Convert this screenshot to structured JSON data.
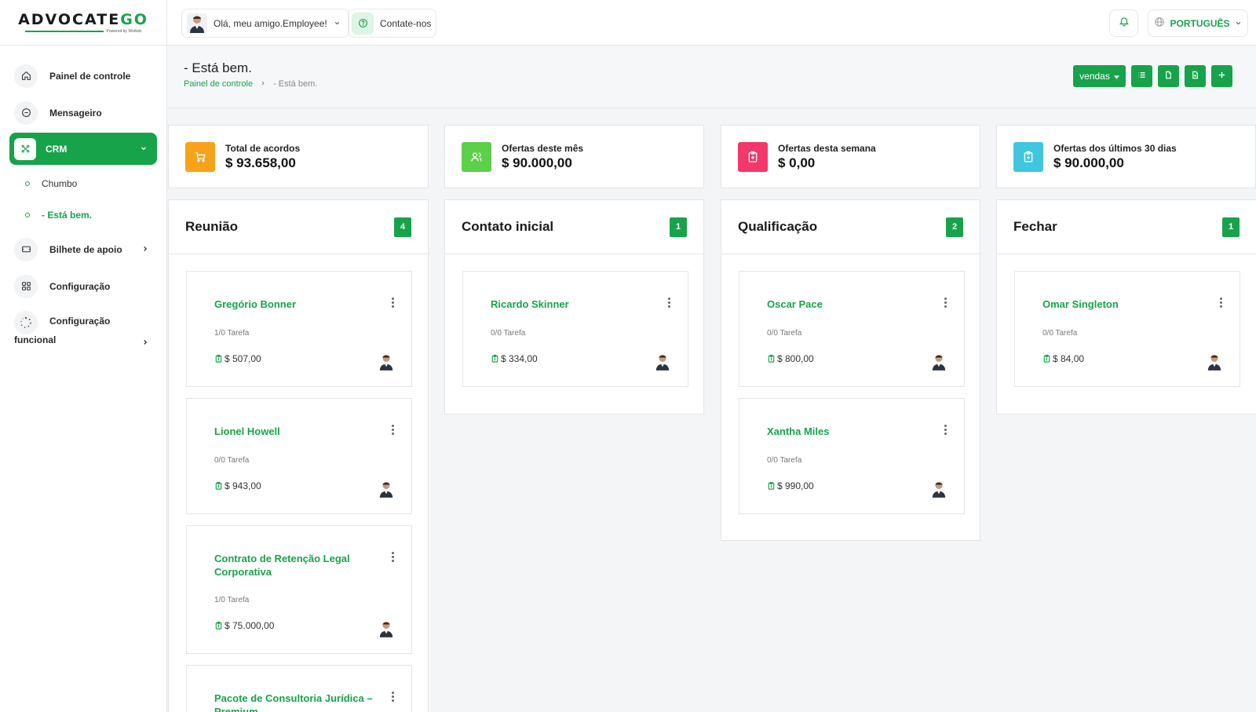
{
  "brand": {
    "name_a": "ADVOCATE",
    "name_b": "GO",
    "powered": "Powered by Workdo"
  },
  "colors": {
    "accent": "#17a34a",
    "orange": "#f7a21b",
    "lime": "#5cd048",
    "pink": "#f4376b",
    "cyan": "#3ec7de"
  },
  "sidebar": {
    "items": [
      {
        "label": "Painel de controle",
        "icon": "home-icon"
      },
      {
        "label": "Mensageiro",
        "icon": "chat-icon"
      },
      {
        "label": "CRM",
        "icon": "crm-icon"
      },
      {
        "label": "Bilhete de apoio",
        "icon": "ticket-icon"
      },
      {
        "label": "Configuração",
        "icon": "grid-icon"
      },
      {
        "label": "Configuração",
        "label2": "funcional",
        "icon": "loader-icon"
      }
    ],
    "sub": [
      {
        "label": "Chumbo"
      },
      {
        "label": "- Está bem."
      }
    ]
  },
  "topbar": {
    "greeting": "Olá, meu amigo.Employee!",
    "contact": "Contate-nos",
    "language": "PORTUGUÊS"
  },
  "page": {
    "title": "- Está bem.",
    "crumb_home": "Painel de controle",
    "crumb_current": "- Está bem.",
    "vendas_label": "vendas"
  },
  "stats": [
    {
      "label": "Total de acordos",
      "value": "$ 93.658,00",
      "icon": "cart-icon"
    },
    {
      "label": "Ofertas deste mês",
      "value": "$ 90.000,00",
      "icon": "users-icon"
    },
    {
      "label": "Ofertas desta semana",
      "value": "$ 0,00",
      "icon": "clipboard-icon"
    },
    {
      "label": "Ofertas dos últimos 30 dias",
      "value": "$ 90.000,00",
      "icon": "clipboard-icon"
    }
  ],
  "columns": [
    {
      "title": "Reunião",
      "count": "4",
      "cards": [
        {
          "name": "Gregório Bonner",
          "task": "1/0 Tarefa",
          "amount": "$ 507,00"
        },
        {
          "name": "Lionel Howell",
          "task": "0/0 Tarefa",
          "amount": "$ 943,00"
        },
        {
          "name": "Contrato de Retenção Legal Corporativa",
          "task": "1/0 Tarefa",
          "amount": "$ 75.000,00"
        },
        {
          "name": "Pacote de Consultoria Jurídica – Premium",
          "task": "",
          "amount": ""
        }
      ]
    },
    {
      "title": "Contato inicial",
      "count": "1",
      "cards": [
        {
          "name": "Ricardo Skinner",
          "task": "0/0 Tarefa",
          "amount": "$ 334,00"
        }
      ]
    },
    {
      "title": "Qualificação",
      "count": "2",
      "cards": [
        {
          "name": "Oscar Pace",
          "task": "0/0 Tarefa",
          "amount": "$ 800,00"
        },
        {
          "name": "Xantha Miles",
          "task": "0/0 Tarefa",
          "amount": "$ 990,00"
        }
      ]
    },
    {
      "title": "Fechar",
      "count": "1",
      "cards": [
        {
          "name": "Omar Singleton",
          "task": "0/0 Tarefa",
          "amount": "$ 84,00"
        }
      ]
    }
  ]
}
